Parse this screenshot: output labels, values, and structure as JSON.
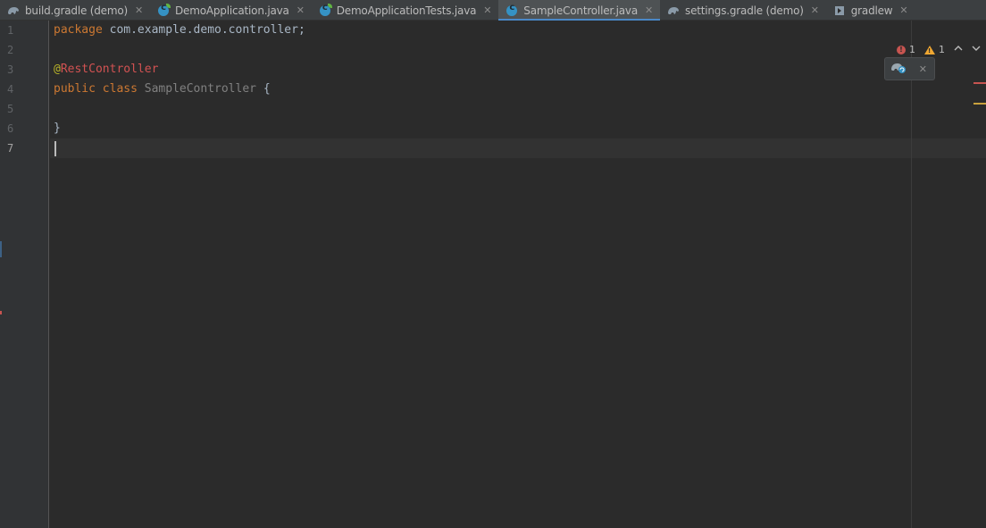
{
  "tabs": [
    {
      "label": "build.gradle (demo)",
      "icon": "gradle-elephant-icon",
      "active": false
    },
    {
      "label": "DemoApplication.java",
      "icon": "java-class-icon",
      "active": false
    },
    {
      "label": "DemoApplicationTests.java",
      "icon": "java-class-icon",
      "active": false
    },
    {
      "label": "SampleController.java",
      "icon": "java-class-icon",
      "active": true
    },
    {
      "label": "settings.gradle (demo)",
      "icon": "gradle-elephant-icon",
      "active": false
    },
    {
      "label": "gradlew",
      "icon": "run-script-icon",
      "active": false
    }
  ],
  "tab_close_glyph": "✕",
  "line_numbers": [
    "1",
    "2",
    "3",
    "4",
    "5",
    "6",
    "7"
  ],
  "code": {
    "line1": {
      "keyword": "package",
      "rest": " com.example.demo.controller;"
    },
    "line3": {
      "at": "@",
      "annotation": "RestController"
    },
    "line4": {
      "kw_public": "public",
      "kw_class": "class",
      "class_name": "SampleController",
      "brace": "{"
    },
    "line6": {
      "brace": "}"
    }
  },
  "inspections": {
    "errors": "1",
    "warnings": "1",
    "up_glyph": "⌃",
    "down_glyph": "⌄"
  },
  "popup": {
    "icon": "gradle-reload-icon",
    "close_glyph": "✕"
  },
  "colors": {
    "background": "#2b2b2b",
    "keyword": "#cc7832",
    "annotation_error": "#d25252",
    "class_name": "#808080",
    "accent": "#4a88c7",
    "error": "#c75450",
    "warning": "#f0a732"
  }
}
